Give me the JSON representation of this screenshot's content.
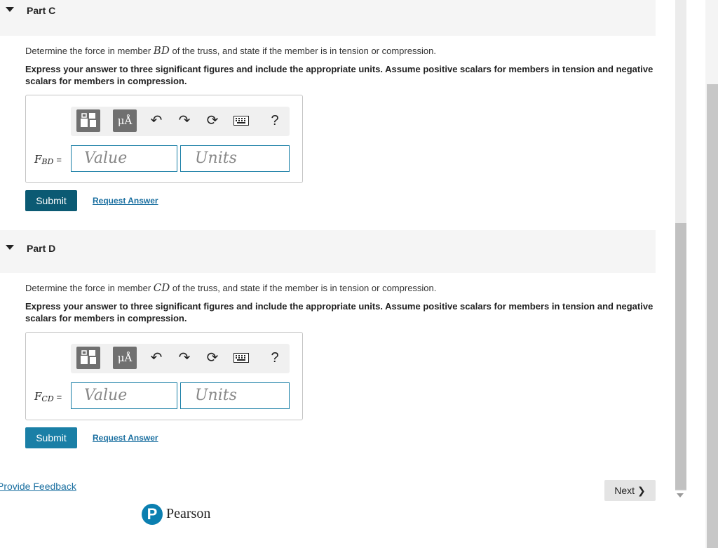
{
  "parts": [
    {
      "title": "Part C",
      "question_pre": "Determine the force in member ",
      "member": "BD",
      "question_post": " of the truss, and state if the member is in tension or compression.",
      "instruction": "Express your answer to three significant figures and include the appropriate units. Assume positive scalars for members in tension and negative scalars for members in compression.",
      "label_main": "F",
      "label_sub": "BD",
      "label_eq": "=",
      "value_placeholder": "Value",
      "units_placeholder": "Units",
      "submit_label": "Submit",
      "submit_color": "#0b5a73",
      "request_label": "Request Answer"
    },
    {
      "title": "Part D",
      "question_pre": "Determine the force in member ",
      "member": "CD",
      "question_post": " of the truss, and state if the member is in tension or compression.",
      "instruction": "Express your answer to three significant figures and include the appropriate units. Assume positive scalars for members in tension and negative scalars for members in compression.",
      "label_main": "F",
      "label_sub": "CD",
      "label_eq": "=",
      "value_placeholder": "Value",
      "units_placeholder": "Units",
      "submit_label": "Submit",
      "submit_color": "#1a7fa6",
      "request_label": "Request Answer"
    }
  ],
  "toolbar": {
    "units_symbol": "μÅ",
    "undo_icon": "↶",
    "redo_icon": "↷",
    "reset_icon": "⟳",
    "keyboard_icon": "keyboard",
    "help_label": "?"
  },
  "footer": {
    "feedback_label": "Provide Feedback",
    "next_label": "Next",
    "brand": "Pearson",
    "brand_initial": "P"
  }
}
